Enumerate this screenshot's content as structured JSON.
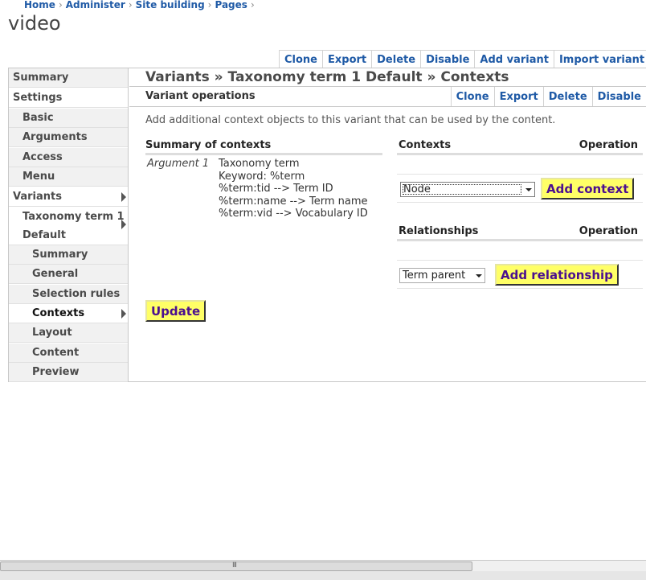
{
  "breadcrumb": [
    "Home",
    "Administer",
    "Site building",
    "Pages"
  ],
  "breadcrumb_sep": "›",
  "page_title": "video",
  "top_ops": [
    "Clone",
    "Export",
    "Delete",
    "Disable",
    "Add variant",
    "Import variant"
  ],
  "nav": {
    "summary": "Summary",
    "settings": "Settings",
    "basic": "Basic",
    "arguments": "Arguments",
    "access": "Access",
    "menu": "Menu",
    "variants": "Variants",
    "variant_line1": "Taxonomy term 1",
    "variant_line2": "Default",
    "v_summary": "Summary",
    "v_general": "General",
    "v_selection": "Selection rules",
    "v_contexts": "Contexts",
    "v_layout": "Layout",
    "v_content": "Content",
    "v_preview": "Preview"
  },
  "content": {
    "title": "Variants » Taxonomy term 1 Default » Contexts",
    "variant_ops_label": "Variant operations",
    "variant_ops": [
      "Clone",
      "Export",
      "Delete",
      "Disable"
    ],
    "description": "Add additional context objects to this variant that can be used by the content.",
    "summary_heading": "Summary of contexts",
    "argument_label": "Argument 1",
    "argument_lines": [
      "Taxonomy term",
      "Keyword: %term",
      "%term:tid --> Term ID",
      "%term:name --> Term name",
      "%term:vid --> Vocabulary ID"
    ],
    "contexts_heading": "Contexts",
    "operation_heading": "Operation",
    "context_select": "Node",
    "add_context": "Add context",
    "relationships_heading": "Relationships",
    "relationship_select": "Term parent",
    "add_relationship": "Add relationship",
    "update": "Update"
  },
  "scrollbar_grip": "III",
  "colors": {
    "link": "#1f5aa6",
    "button_bg": "#ffff66",
    "button_text": "#4b0f8f"
  }
}
